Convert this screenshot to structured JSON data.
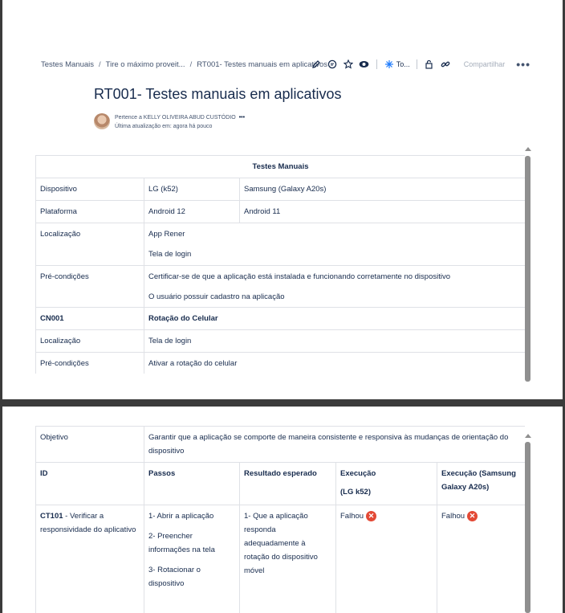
{
  "breadcrumb": {
    "items": [
      "Testes Manuais",
      "Tire o máximo proveit...",
      "RT001- Testes manuais em aplicativos"
    ],
    "separator": "/"
  },
  "toolbar": {
    "ai_label": "To...",
    "share_label": "Compartilhar",
    "more_label": "•••"
  },
  "page": {
    "title": "RT001- Testes manuais em aplicativos",
    "owner_line": "Pertence a KELLY OLIVEIRA ABUD CUSTÓDIO",
    "owner_more": "•••",
    "updated_line": "Última atualização em: agora há pouco"
  },
  "table1": {
    "header": "Testes Manuais",
    "rows": {
      "dispositivo": {
        "label": "Dispositivo",
        "v1": "LG (k52)",
        "v2": "Samsung (Galaxy A20s)"
      },
      "plataforma": {
        "label": "Plataforma",
        "v1": "Android 12",
        "v2": "Android 11"
      },
      "localizacao": {
        "label": "Localização",
        "l1": "App Rener",
        "l2": "Tela de login"
      },
      "precond": {
        "label": "Pré-condições",
        "l1": "Certificar-se de que a aplicação está instalada e funcionando corretamente no dispositivo",
        "l2": "O usuário possuir cadastro na aplicação"
      },
      "cn": {
        "label": "CN001",
        "value": "Rotação do Celular"
      },
      "localizacao2": {
        "label": "Localização",
        "value": "Tela de login"
      },
      "precond2": {
        "label": "Pré-condições",
        "value": "Ativar a rotação do celular"
      }
    }
  },
  "table2": {
    "objetivo": {
      "label": "Objetivo",
      "value": "Garantir que a aplicação se comporte de maneira consistente e responsiva às mudanças de orientação do dispositivo"
    },
    "headers": {
      "id": "ID",
      "passos": "Passos",
      "resultado": "Resultado esperado",
      "exec1_a": "Execução",
      "exec1_b": "(LG k52)",
      "exec2": "Execução (Samsung Galaxy A20s)"
    },
    "row": {
      "id_bold": "CT101",
      "id_rest": " - Verificar a responsividade do aplicativo",
      "step1": "1- Abrir a aplicação",
      "step2": "2- Preencher informações na tela",
      "step3": "3- Rotacionar o dispositivo",
      "expected": "1- Que a aplicação responda adequadamente à rotação do dispositivo móvel",
      "exec1": "Falhou",
      "exec2": "Falhou"
    }
  },
  "colors": {
    "fail": "#e34935",
    "text": "#172b4d",
    "border": "#dfe1e6"
  }
}
